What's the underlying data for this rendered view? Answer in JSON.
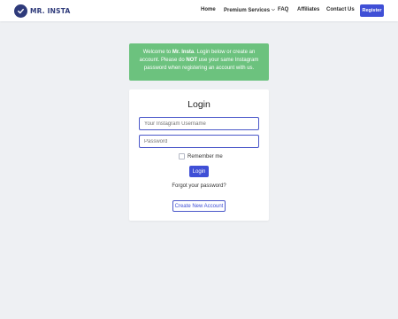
{
  "brand": {
    "logo_text": "MR. INSTA",
    "icon": "shield-check-icon",
    "color": "#2e3a7a"
  },
  "nav": {
    "home": "Home",
    "premium": "Premium Services",
    "premium_icon": "chevron-down-icon",
    "faq": "FAQ",
    "affiliates": "Affiliates",
    "contact": "Contact Us",
    "register": "Register"
  },
  "alert": {
    "part1": "Welcome to ",
    "brand": "Mr. Insta",
    "part2": ". Login below or create an account. Please do ",
    "emphasis": "NOT",
    "part3": " use your same Instagram password when registering an account with us.",
    "color": "#6cc27e"
  },
  "login": {
    "title": "Login",
    "username_placeholder": "Your Instagram Username",
    "password_placeholder": "Password",
    "remember": "Remember me",
    "submit": "Login",
    "forgot": "Forgot your password?",
    "create": "Create New Account",
    "accent": "#3f4fd6"
  }
}
